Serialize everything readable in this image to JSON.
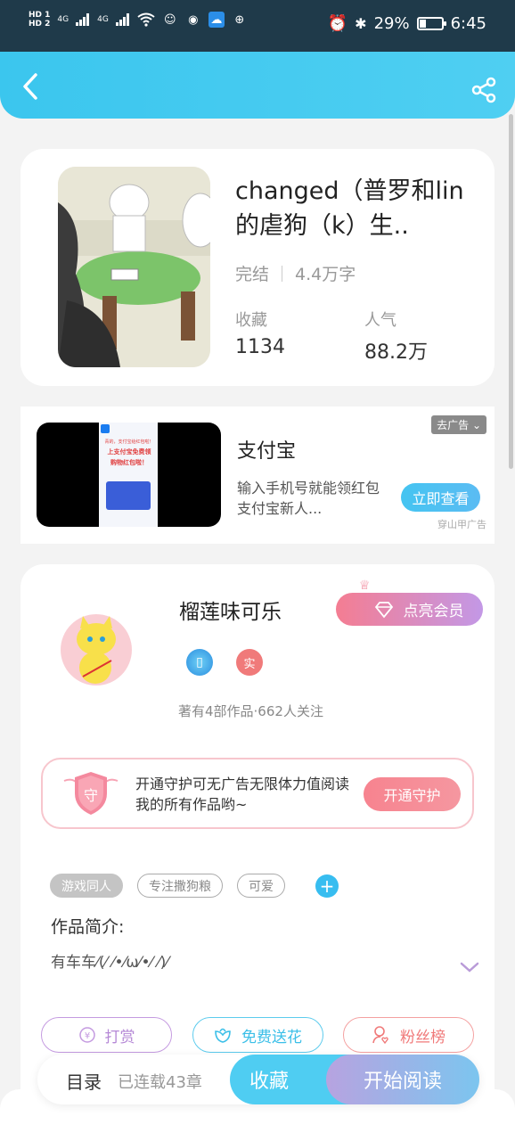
{
  "status_bar": {
    "hd1": "HD 1",
    "hd2": "HD 2",
    "net1": "4G",
    "net2": "4G",
    "battery_percent": "29%",
    "time": "6:45",
    "battery_level": 0.29
  },
  "header": {
    "back_icon": "chevron-left-icon",
    "share_icon": "share-icon",
    "color": "#3bc6ee"
  },
  "book": {
    "title": "changed（普罗和lin的虐狗（k）生..",
    "status": "完结",
    "word_count": "4.4万字",
    "favorites_label": "收藏",
    "favorites_value": "1134",
    "popularity_label": "人气",
    "popularity_value": "88.2万"
  },
  "ad": {
    "title": "支付宝",
    "description": "输入手机号就能领红包支付宝新人...",
    "close_label": "去广告",
    "cta_label": "立即查看",
    "source": "穿山甲广告",
    "poster_line1": "青的，支付宝给红包啦！",
    "poster_line2": "上支付宝免费领",
    "poster_line3": "购物红包啦！"
  },
  "author": {
    "name": "榴莲味可乐",
    "vip_label": "点亮会员",
    "badge_real": "实",
    "stats": "著有4部作品·662人关注",
    "guard_icon_text": "守",
    "guard_text": "开通守护可无广告无限体力值阅读我的所有作品哟~",
    "guard_btn": "开通守护",
    "tags": [
      "游戏同人",
      "专注撒狗粮",
      "可爱"
    ],
    "intro_title": "作品简介:",
    "intro_text": "有车车⁄(⁄ ⁄•⁄ω⁄•⁄ ⁄)⁄",
    "actions": {
      "tip": "打赏",
      "flower": "免费送花",
      "fans": "粉丝榜"
    }
  },
  "bottom_bar": {
    "toc": "目录",
    "chapters": "已连载43章",
    "favorite": "收藏",
    "start_reading": "开始阅读"
  }
}
